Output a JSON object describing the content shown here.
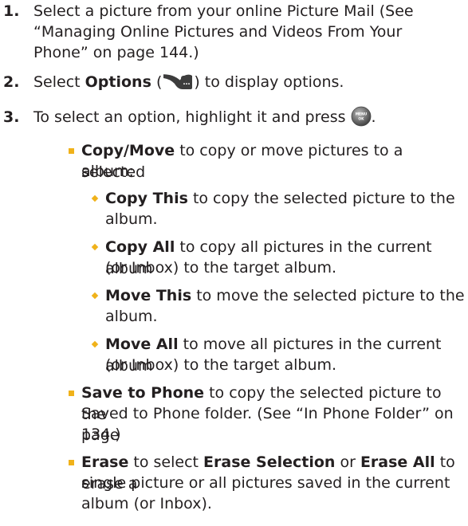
{
  "steps": [
    {
      "num": "1.",
      "lines": [
        "Select a picture from your online Picture Mail (See",
        "“Managing Online Pictures and Videos From Your",
        "Phone” on page 144.)"
      ]
    },
    {
      "num": "2.",
      "pre": "Select ",
      "bold": "Options",
      "mid": " (",
      "post": ") to display options."
    },
    {
      "num": "3.",
      "pre": "To select an option, highlight it and press ",
      "post": "."
    }
  ],
  "icons": {
    "options_key": "options-softkey-icon",
    "menu_ok": "menu-ok-button-icon",
    "key_glyph": "…",
    "menu_glyph": "MENU",
    "ok_glyph": "OK"
  },
  "bullets": {
    "copy_move": {
      "bold": "Copy/Move",
      "line1": " to copy or move pictures to a selected",
      "line2": "album:"
    },
    "copy_this": {
      "bold": "Copy This",
      "line1": " to copy the selected picture to the",
      "line2": "album."
    },
    "copy_all": {
      "bold": "Copy All",
      "line1": " to copy all pictures in the current album",
      "line2": "(or Inbox) to the target album."
    },
    "move_this": {
      "bold": "Move This",
      "line1": " to move the selected picture to the",
      "line2": "album."
    },
    "move_all": {
      "bold": "Move All",
      "line1": " to move all pictures in the current album",
      "line2": "(or Inbox) to the target album."
    },
    "save_to_phone": {
      "bold": "Save to Phone",
      "line1": " to copy the selected picture to the",
      "line2": "Saved to Phone folder. (See “In Phone Folder” on page",
      "line3": "134.)"
    },
    "erase": {
      "bold": "Erase",
      "line1a": " to select ",
      "bold2": "Erase Selection",
      "line1b": " or ",
      "bold3": "Erase All",
      "line1c": " to erase a",
      "line2": "single picture or all pictures saved in the current",
      "line3": "album (or Inbox)."
    }
  },
  "colors": {
    "bullet": "#f0b21a",
    "text": "#231f20"
  }
}
